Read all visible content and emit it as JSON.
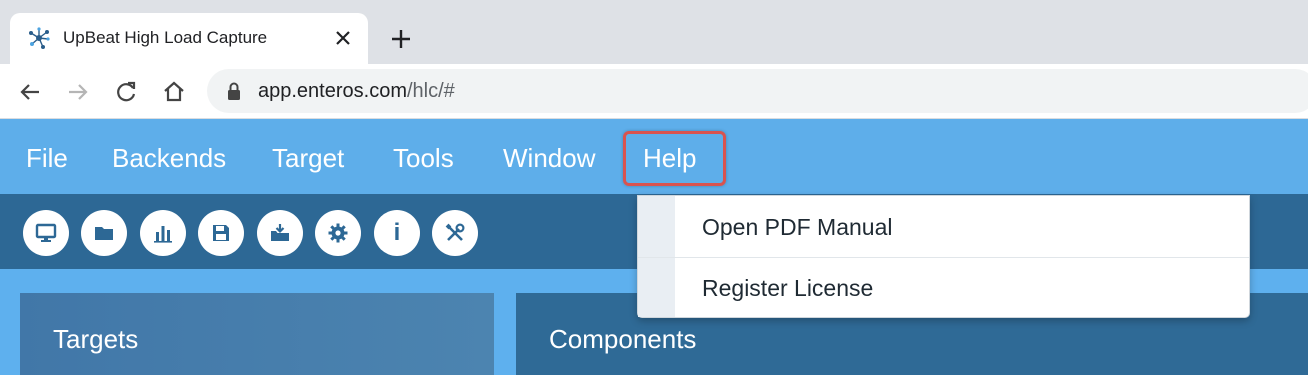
{
  "browser": {
    "tab": {
      "title": "UpBeat High Load Capture",
      "favicon": "network-icon"
    },
    "address": {
      "host": "app.enteros.com",
      "path": "/hlc/#"
    }
  },
  "menubar": {
    "items": [
      "File",
      "Backends",
      "Target",
      "Tools",
      "Window",
      "Help"
    ],
    "active": "Help"
  },
  "toolbar": {
    "buttons": [
      "monitor-icon",
      "folder-icon",
      "bar-chart-icon",
      "save-icon",
      "download-icon",
      "gear-icon",
      "info-icon",
      "tools-icon"
    ],
    "info_glyph": "i"
  },
  "help_menu": {
    "items": [
      "Open PDF Manual",
      "Register License"
    ]
  },
  "panels": {
    "targets": "Targets",
    "components": "Components"
  },
  "colors": {
    "menubar": "#5eaeea",
    "toolbar": "#2d6895",
    "highlight": "#d9534f"
  }
}
